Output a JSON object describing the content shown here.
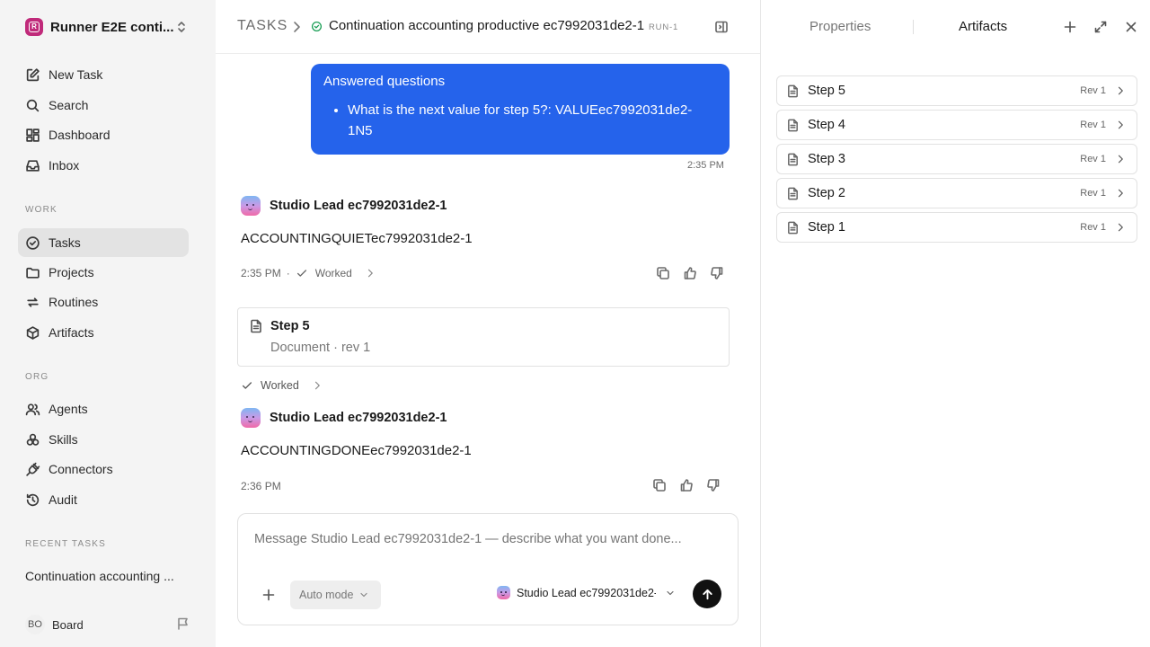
{
  "sidebar": {
    "workspace": {
      "initial": "R",
      "name": "Runner E2E conti..."
    },
    "top_items": [
      {
        "label": "New Task"
      },
      {
        "label": "Search"
      },
      {
        "label": "Dashboard"
      },
      {
        "label": "Inbox"
      }
    ],
    "work_label": "WORK",
    "work_items": [
      {
        "label": "Tasks"
      },
      {
        "label": "Projects"
      },
      {
        "label": "Routines"
      },
      {
        "label": "Artifacts"
      }
    ],
    "org_label": "ORG",
    "org_items": [
      {
        "label": "Agents"
      },
      {
        "label": "Skills"
      },
      {
        "label": "Connectors"
      },
      {
        "label": "Audit"
      }
    ],
    "recent_label": "RECENT TASKS",
    "recent_items": [
      {
        "label": "Continuation accounting ..."
      }
    ],
    "user": {
      "initials": "BO",
      "name": "Board"
    }
  },
  "header": {
    "root": "TASKS",
    "title": "Continuation accounting productive ec7992031de2-1",
    "badge": "RUN-1"
  },
  "conversation": {
    "user_message": {
      "title": "Answered questions",
      "bullets": [
        "What is the next value for step 5?: VALUEec7992031de2-1N5"
      ],
      "time": "2:35 PM"
    },
    "agent_messages": [
      {
        "agent": "Studio Lead ec7992031de2-1",
        "text": "ACCOUNTINGQUIETec7992031de2-1",
        "time": "2:35 PM",
        "status": "Worked"
      },
      {
        "agent": "Studio Lead ec7992031de2-1",
        "text": "ACCOUNTINGDONEec7992031de2-1",
        "time": "2:36 PM"
      }
    ],
    "doc_card": {
      "title": "Step 5",
      "subtitle": "Document · rev 1"
    },
    "worked_label": "Worked"
  },
  "composer": {
    "placeholder": "Message Studio Lead ec7992031de2-1 — describe what you want done...",
    "mode": "Auto mode",
    "agent": "Studio Lead ec7992031de2-1"
  },
  "right_panel": {
    "tabs": [
      {
        "label": "Properties",
        "active": false
      },
      {
        "label": "Artifacts",
        "active": true
      }
    ],
    "artifacts": [
      {
        "name": "Step 5",
        "rev": "Rev 1"
      },
      {
        "name": "Step 4",
        "rev": "Rev 1"
      },
      {
        "name": "Step 3",
        "rev": "Rev 1"
      },
      {
        "name": "Step 2",
        "rev": "Rev 1"
      },
      {
        "name": "Step 1",
        "rev": "Rev 1"
      }
    ]
  },
  "colors": {
    "accent": "#2563eb",
    "workspace_logo": "#c02a7a",
    "success": "#1a9e55",
    "sidebar_bg": "#f4f4f4"
  }
}
